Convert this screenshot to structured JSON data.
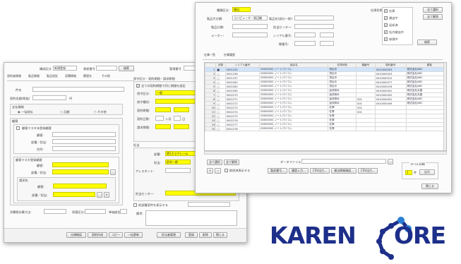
{
  "back_window": {
    "header": {
      "type_label": "構成区分",
      "type_value": "新規登録",
      "asset_no_label": "資産番号",
      "search_button": "検索",
      "mgmt_no_label": "管理番号"
    },
    "tabs": [
      "契約者情報",
      "製品情報",
      "製品保証",
      "見積情報",
      "関連先",
      "その他"
    ],
    "name_label": "件名",
    "contract_label": "契約金額(税抜)",
    "yen": "円",
    "payment_group": "支払情報",
    "payment_radios": [
      "一括前払",
      "月額",
      "その他"
    ],
    "customer_group": "顧客",
    "customer_master_check": "顧客マスタ未登録顧客",
    "customer_fields": [
      "顧客:",
      "部署／担当:",
      "住所:"
    ],
    "master_group": "顧客マスタ登録顧客",
    "master_fields": [
      "顧客:",
      "部署／担当:"
    ],
    "contact_group": "請求先",
    "contact_fields": [
      "顧客:",
      "部署／担当:"
    ],
    "bottom_labels": [
      "消費税計算方法:",
      "保管区分:",
      "単価設定:"
    ],
    "right_group_title": "保守区分・契約期間・請求期間",
    "right_check": "全ての契約期間で同じ期間を設定",
    "right_fields": [
      "保守区分:",
      "保守種別:",
      "契約期間:",
      "契約日数:",
      "請求期間:"
    ],
    "maint_value": "一般",
    "months_text": "ヶ月",
    "day_text": "日",
    "lower_group_title": "担当",
    "dept_label": "部署:",
    "dept_value": "第1カラクレーム",
    "person_label": "担当:",
    "person_value": "鈴木一郎",
    "assistant_label": "アシスタント:",
    "center_label": "担当センター:",
    "bottom_check": "他部署案件を表示する",
    "note_label": "備考:",
    "footer_buttons": [
      "仕様確認",
      "契約作成",
      "コピー",
      "一括更新",
      "担当者管理",
      "登録",
      "削除",
      "閉じる"
    ]
  },
  "front_window": {
    "filters": {
      "type_label": "種類区分:",
      "type_value": "貸出",
      "category_label": "製品大分類:",
      "category_value": "コンピュータ・周辺機",
      "mid_label": "製品分類:",
      "maker_label": "メーカー:",
      "product_label": "製品名(部分一致):",
      "center_label": "担当センター:",
      "serial_label": "シリアル番号:",
      "number_label": "棚番号:",
      "status_label": "在庫状態:",
      "status_items": [
        "在庫",
        "貸出中",
        "返却済",
        "社内貸出中",
        "修理中"
      ],
      "select_all": "全て選択",
      "clear_all": "全て解除",
      "search_button": "検索"
    },
    "tabs": [
      "在庫一覧",
      "在庫履歴"
    ],
    "grid": {
      "headers": [
        "",
        "状態",
        "シリアル番号",
        "製品名",
        "在庫状態",
        "棚番号",
        "契約番号",
        "顧客"
      ],
      "rows": [
        [
          "1",
          "■",
          "0001235",
          "00000002 ノートパソコン",
          "貸出中",
          "",
          "0010000003",
          "株式会社ABC"
        ],
        [
          "2",
          "□",
          "0001236",
          "00000002 ノートパソコン",
          "貸出中",
          "",
          "0010000003",
          "株式会社ABC"
        ],
        [
          "3",
          "□",
          "0001237",
          "00000002 ノートパソコン",
          "貸出中",
          "",
          "0010000010",
          "株式会社ABC"
        ],
        [
          "4",
          "□",
          "0002262",
          "00000002 ノートパソコン",
          "貸出中",
          "",
          "0010000077",
          "株式会社ABC"
        ],
        [
          "5",
          "□",
          "0002263",
          "00000002 ノートパソコン",
          "貸出中",
          "",
          "0010000078",
          "株式会社ABC"
        ],
        [
          "6",
          "□",
          "0002269",
          "00000002 ノートパソコン",
          "返却済み",
          "",
          "0010000001",
          "株式会社丸善"
        ],
        [
          "7",
          "□",
          "0002270",
          "00000002 ノートパソコン",
          "返却済み",
          "",
          "0010000002",
          "株式会社丸善"
        ],
        [
          "8",
          "□",
          "0002271",
          "00000002 ノートパソコン",
          "返却済み",
          "001",
          "0010000001",
          "株式会社ABC"
        ],
        [
          "9",
          "□",
          "0002272",
          "00000002 ノートパソコン",
          "返却済み",
          "001",
          "0010000049",
          "株式会社ABC"
        ],
        [
          "10",
          "□",
          "0002273",
          "00000002 ノートパソコン",
          "在庫",
          "001",
          "",
          ""
        ],
        [
          "11",
          "□",
          "0002274",
          "00000002 ノートパソコン",
          "在庫",
          "001",
          "",
          ""
        ],
        [
          "12",
          "□",
          "0002275",
          "00000002 ノートパソコン",
          "在庫",
          "",
          "",
          ""
        ],
        [
          "13",
          "□",
          "0002276",
          "00000002 ノートパソコン",
          "在庫",
          "",
          "",
          ""
        ],
        [
          "14",
          "□",
          "0002277",
          "00000002 ノートパソコン",
          "在庫",
          "",
          "",
          ""
        ],
        [
          "15",
          "□",
          "0002278",
          "00000002 ノートパソコン",
          "在庫",
          "",
          "",
          ""
        ]
      ]
    },
    "bottom": {
      "select_all": "全て選択",
      "clear_all": "全て解除",
      "plus": "+",
      "minus": "−",
      "show_deleted": "削除済表示する",
      "data_file_label": "データファイル:",
      "actions": [
        "製造番号...",
        "履歴入力...",
        "CSV出力...",
        "貸出情報確認...",
        "CSV出力..."
      ],
      "label_group": "ラベル印刷",
      "count_value": "1",
      "count_unit": "件",
      "print_button": "出力",
      "close_button": "閉じる"
    }
  },
  "logo": {
    "text_left": "KAREN",
    "text_right": "ORE",
    "color": "#1d2f8a",
    "accent": "#2a7fd4"
  }
}
